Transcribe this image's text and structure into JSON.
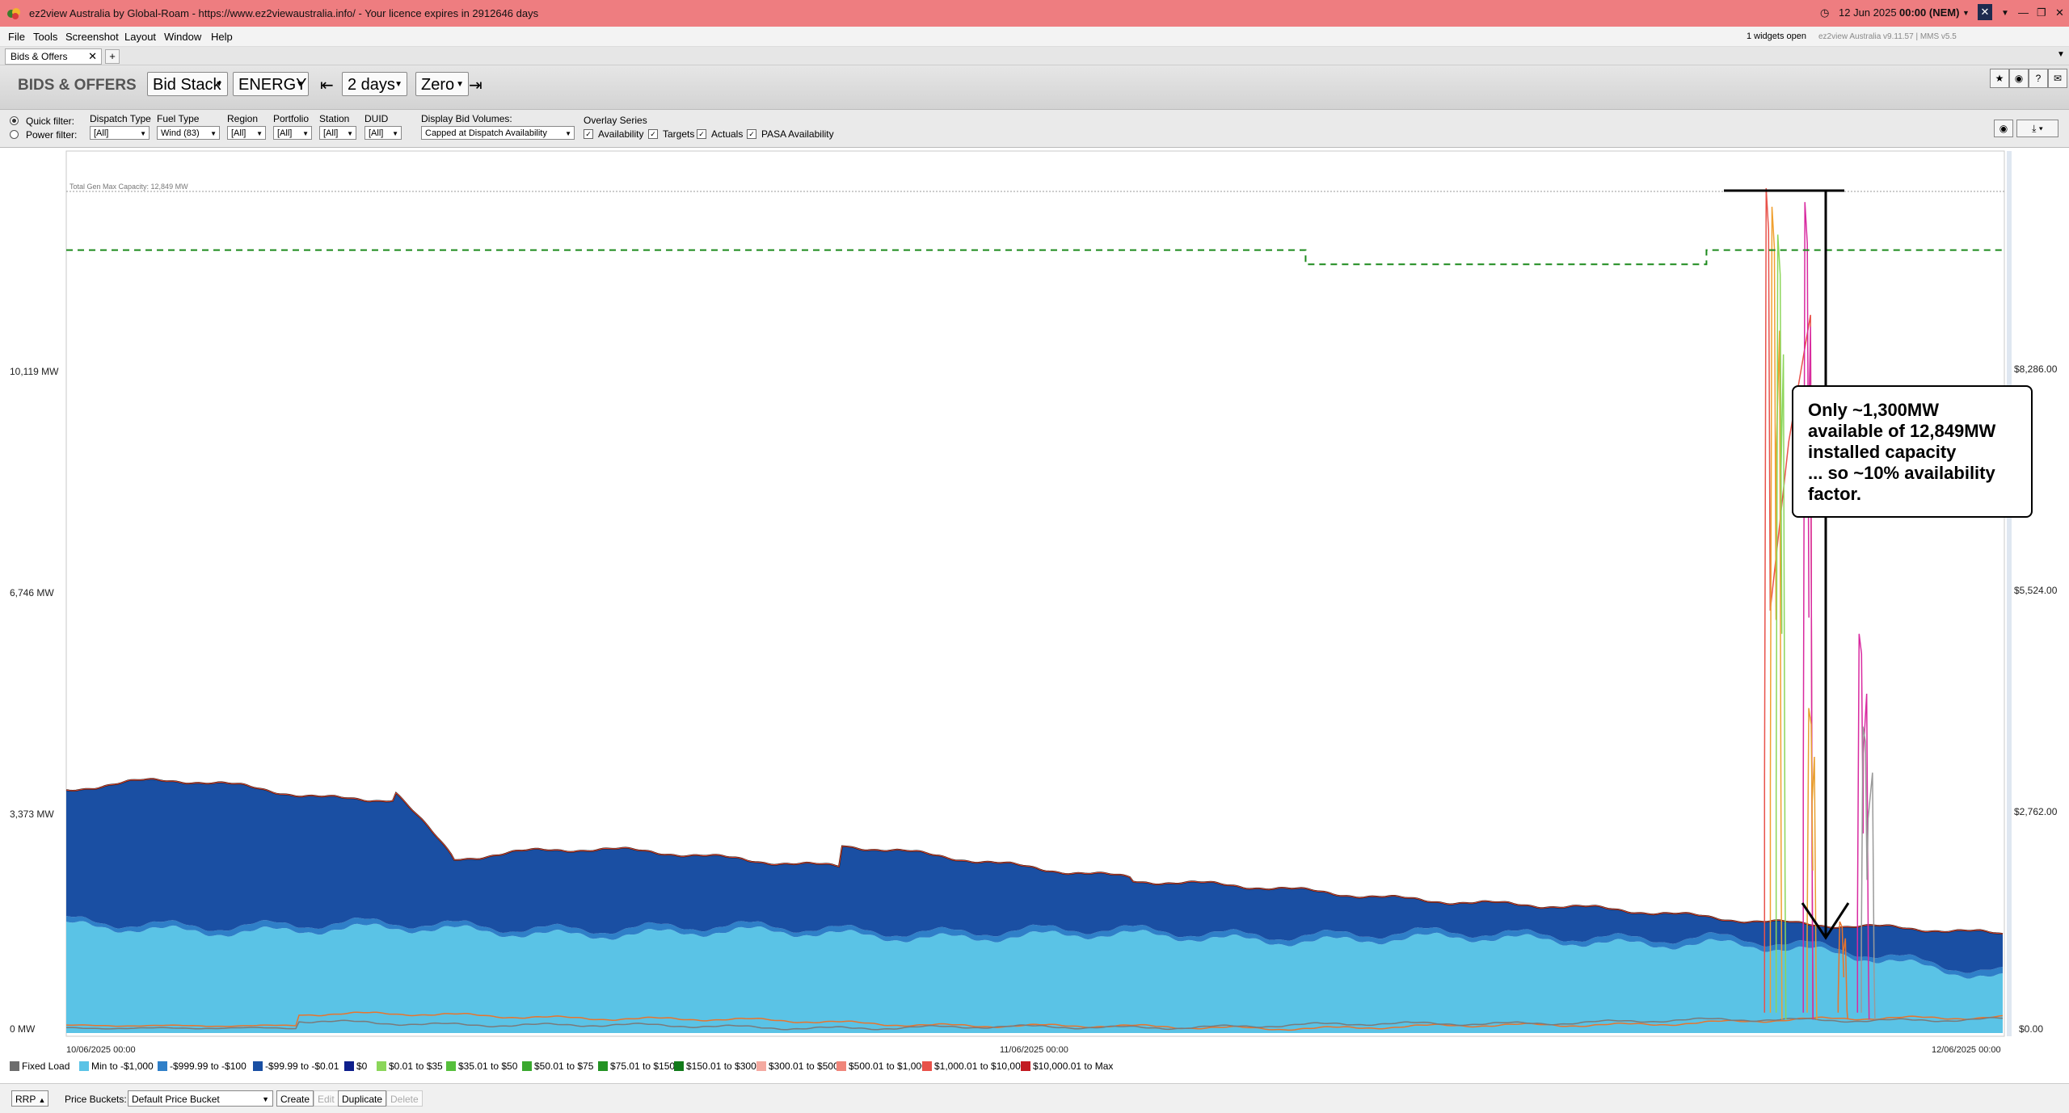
{
  "window": {
    "title": "ez2view Australia by Global-Roam - https://www.ez2viewaustralia.info/ - Your licence expires in 2912646 days",
    "clock_date": "12 Jun 2025",
    "clock_time": "00:00 (NEM)"
  },
  "menu": [
    "File",
    "Tools",
    "Screenshot",
    "Layout",
    "Window",
    "Help"
  ],
  "status": {
    "widgets_open": "1 widgets open",
    "version": "ez2view Australia v9.11.57 | MMS v5.5"
  },
  "tabs": [
    {
      "label": "Bids & Offers"
    }
  ],
  "toolbar": {
    "title": "BIDS & OFFERS",
    "view_select": "Bid Stack",
    "market_select": "ENERGY",
    "period_select": "2 days",
    "zero_select": "Zero"
  },
  "filters": {
    "quick_filter": "Quick filter:",
    "power_filter": "Power filter:",
    "dispatch_type": {
      "label": "Dispatch Type",
      "value": "[All]"
    },
    "fuel_type": {
      "label": "Fuel Type",
      "value": "Wind (83)"
    },
    "region": {
      "label": "Region",
      "value": "[All]"
    },
    "portfolio": {
      "label": "Portfolio",
      "value": "[All]"
    },
    "station": {
      "label": "Station",
      "value": "[All]"
    },
    "duid": {
      "label": "DUID",
      "value": "[All]"
    },
    "display_bid_volumes": {
      "label": "Display Bid Volumes:",
      "value": "Capped at Dispatch Availability"
    },
    "overlay_series": {
      "label": "Overlay Series",
      "items": [
        "Availability",
        "Targets",
        "Actuals",
        "PASA Availability"
      ]
    }
  },
  "chart": {
    "capacity_label": "Total Gen Max Capacity: 12,849 MW",
    "y_left_ticks": [
      "10,119 MW",
      "6,746 MW",
      "3,373 MW",
      "0 MW"
    ],
    "y_right_ticks": [
      "$8,286.00",
      "$5,524.00",
      "$2,762.00",
      "$0.00"
    ],
    "x_ticks": [
      "10/06/2025 00:00",
      "11/06/2025 00:00",
      "12/06/2025 00:00"
    ],
    "annotation": [
      "Only ~1,300MW",
      "available of 12,849MW",
      "installed capacity",
      "... so ~10% availability",
      "factor."
    ]
  },
  "chart_data": {
    "type": "area",
    "x": [
      "10/06/2025 00:00",
      "11/06/2025 00:00",
      "12/06/2025 00:00"
    ],
    "ylim": [
      0,
      13000
    ],
    "y2lim": [
      0,
      9500
    ],
    "series": [
      {
        "name": "Fixed Load",
        "values": [
          0,
          0,
          0
        ]
      },
      {
        "name": "Min to -$1,000",
        "values": [
          1550,
          1350,
          700
        ]
      },
      {
        "name": "-$999.99 to -$100",
        "values": [
          80,
          60,
          50
        ]
      },
      {
        "name": "-$99.99 to -$0.01",
        "values": [
          2000,
          1450,
          1000
        ]
      },
      {
        "name": "PASA Availability",
        "values": [
          11540,
          11330,
          11540
        ]
      }
    ],
    "legend": [
      {
        "label": "Fixed Load",
        "color": "#6d6d6d"
      },
      {
        "label": "Min to -$1,000",
        "color": "#5ac3e6"
      },
      {
        "label": "-$999.99 to -$100",
        "color": "#2f7fc8"
      },
      {
        "label": "-$99.99 to -$0.01",
        "color": "#1a4fa3"
      },
      {
        "label": "$0",
        "color": "#0e1f8c"
      },
      {
        "label": "$0.01 to $35",
        "color": "#8bd65a"
      },
      {
        "label": "$35.01 to $50",
        "color": "#56bf3c"
      },
      {
        "label": "$50.01 to $75",
        "color": "#3aa82f"
      },
      {
        "label": "$75.01 to $150",
        "color": "#249324"
      },
      {
        "label": "$150.01 to $300",
        "color": "#127a1a"
      },
      {
        "label": "$300.01 to $500",
        "color": "#f4a9a0"
      },
      {
        "label": "$500.01 to $1,000",
        "color": "#f0857a"
      },
      {
        "label": "$1,000.01 to $10,000",
        "color": "#e8524a"
      },
      {
        "label": "$10,000.01 to Max",
        "color": "#c21a22"
      }
    ]
  },
  "footer": {
    "rrp": "RRP",
    "price_buckets_label": "Price Buckets:",
    "price_bucket_value": "Default Price Bucket",
    "create": "Create",
    "edit": "Edit",
    "duplicate": "Duplicate",
    "delete": "Delete"
  },
  "colors": {
    "titlebar": "#ee7d80",
    "pasa_line": "#1c8a1c"
  }
}
